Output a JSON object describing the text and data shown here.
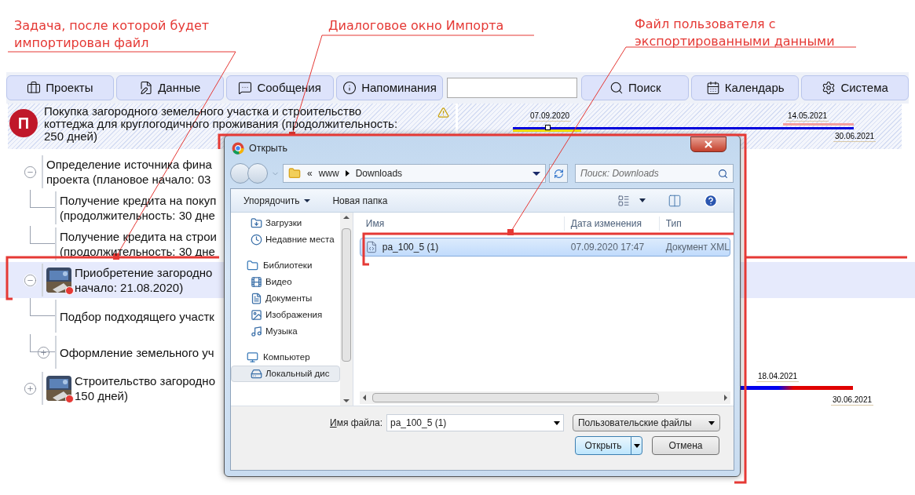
{
  "annotations": [
    {
      "lines": [
        "Задача, после которой будет",
        "импортирован файл"
      ]
    },
    {
      "lines": [
        "Диалоговое окно Импорта"
      ]
    },
    {
      "lines": [
        "Файл пользователя с",
        "экспортированными данными"
      ]
    }
  ],
  "toolbar": {
    "left_buttons": [
      {
        "label": "Проекты"
      },
      {
        "label": "Данные"
      },
      {
        "label": "Сообщения"
      },
      {
        "label": "Напоминания"
      }
    ],
    "right_buttons": [
      {
        "label": "Поиск"
      },
      {
        "label": "Календарь"
      },
      {
        "label": "Система"
      }
    ]
  },
  "project": {
    "badge": "П",
    "lines": [
      "Покупка загородного земельного участка и строительство",
      "коттеджа для круглогодичного проживания (продолжительность:",
      "250 дней)"
    ],
    "warning": true,
    "level": 0.2,
    "gantt_labels": [
      "07.09.2020",
      "14.05.2021",
      "30.06.2021"
    ]
  },
  "tree": [
    {
      "lines": [
        "Определение источника фина",
        "проекта (плановое начало: 03"
      ],
      "expanded": true,
      "selected": false,
      "children": [
        {
          "lines": [
            "Получение кредита на покуп",
            "(продолжительность: 30 дне"
          ],
          "selected": false
        },
        {
          "lines": [
            "Получение кредита на строи",
            "(продолжительность: 30 дне"
          ],
          "selected": false
        }
      ]
    },
    {
      "lines": [
        "Приобретение загородно",
        "начало: 21.08.2020)"
      ],
      "expanded": true,
      "selected": true,
      "thumbnail": {
        "kind": "picture"
      },
      "children": [
        {
          "lines": [
            "Подбор подходящего участк"
          ],
          "selected": false
        },
        {
          "lines": [
            "Оформление земельного уч"
          ],
          "expanded": false,
          "selected": false
        }
      ]
    },
    {
      "lines": [
        "Строительство загородно",
        "150 дней)"
      ],
      "expanded": false,
      "selected": false,
      "thumbnail": {
        "kind": "picture"
      },
      "gantt_labels": [
        "18.04.2021",
        "30.06.2021"
      ]
    }
  ],
  "dialog": {
    "title": "Открыть",
    "path_overflow": "«",
    "path": [
      "www",
      "Downloads"
    ],
    "search_placeholder": "Поиск: Downloads",
    "commands": [
      {
        "label": "Упорядочить"
      },
      {
        "label": "Новая папка"
      }
    ],
    "nav": [
      {
        "children": [
          {
            "label": "Загрузки",
            "selected": false
          },
          {
            "label": "Недавние места",
            "selected": false
          }
        ]
      },
      {
        "label": "Библиотеки",
        "children": [
          {
            "label": "Видео",
            "selected": false
          },
          {
            "label": "Документы",
            "selected": false
          },
          {
            "label": "Изображения",
            "selected": false
          },
          {
            "label": "Музыка",
            "selected": false
          }
        ]
      },
      {
        "label": "Компьютер",
        "children": [
          {
            "label": "Локальный дис",
            "selected": true
          }
        ]
      }
    ],
    "columns": [
      "Имя",
      "Дата изменения",
      "Тип"
    ],
    "files": [
      {
        "name": "pa_100_5 (1)",
        "date": "07.09.2020 17:47",
        "type": "Документ XML",
        "selected": true
      }
    ],
    "filename_label": "Имя файла:",
    "filename": "pa_100_5 (1)",
    "filter": "Пользовательские файлы",
    "buttons": [
      {
        "label": "Открыть",
        "kind": "split"
      },
      {
        "label": "Отмена",
        "kind": "plain"
      }
    ]
  }
}
